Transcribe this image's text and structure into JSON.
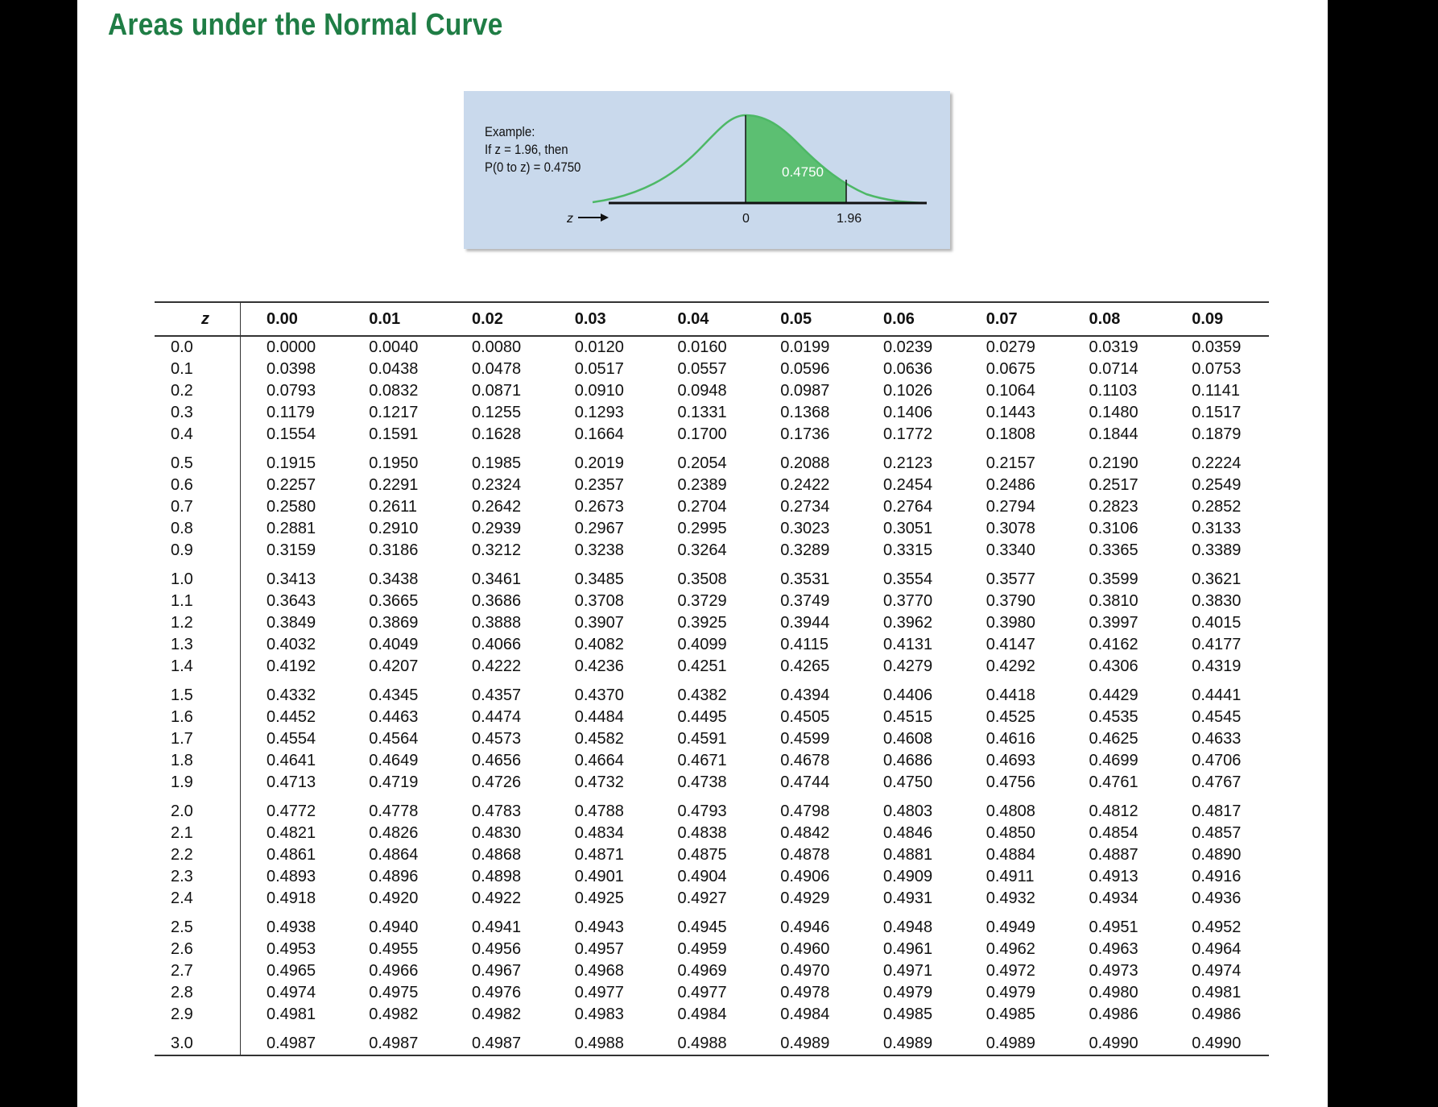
{
  "title": "Areas under the Normal Curve",
  "example": {
    "line1": "Example:",
    "line2": "If z = 1.96, then",
    "line3": "P(0 to z) = 0.4750",
    "area_label": "0.4750",
    "axis_label": "z",
    "tick_zero": "0",
    "tick_z": "1.96",
    "shade_color": "#5cbf72",
    "curve_color": "#4db866"
  },
  "table": {
    "header_z": "z",
    "columns": [
      "0.00",
      "0.01",
      "0.02",
      "0.03",
      "0.04",
      "0.05",
      "0.06",
      "0.07",
      "0.08",
      "0.09"
    ],
    "rows": [
      {
        "z": "0.0",
        "vals": [
          "0.0000",
          "0.0040",
          "0.0080",
          "0.0120",
          "0.0160",
          "0.0199",
          "0.0239",
          "0.0279",
          "0.0319",
          "0.0359"
        ]
      },
      {
        "z": "0.1",
        "vals": [
          "0.0398",
          "0.0438",
          "0.0478",
          "0.0517",
          "0.0557",
          "0.0596",
          "0.0636",
          "0.0675",
          "0.0714",
          "0.0753"
        ]
      },
      {
        "z": "0.2",
        "vals": [
          "0.0793",
          "0.0832",
          "0.0871",
          "0.0910",
          "0.0948",
          "0.0987",
          "0.1026",
          "0.1064",
          "0.1103",
          "0.1141"
        ]
      },
      {
        "z": "0.3",
        "vals": [
          "0.1179",
          "0.1217",
          "0.1255",
          "0.1293",
          "0.1331",
          "0.1368",
          "0.1406",
          "0.1443",
          "0.1480",
          "0.1517"
        ]
      },
      {
        "z": "0.4",
        "vals": [
          "0.1554",
          "0.1591",
          "0.1628",
          "0.1664",
          "0.1700",
          "0.1736",
          "0.1772",
          "0.1808",
          "0.1844",
          "0.1879"
        ]
      },
      {
        "z": "0.5",
        "vals": [
          "0.1915",
          "0.1950",
          "0.1985",
          "0.2019",
          "0.2054",
          "0.2088",
          "0.2123",
          "0.2157",
          "0.2190",
          "0.2224"
        ]
      },
      {
        "z": "0.6",
        "vals": [
          "0.2257",
          "0.2291",
          "0.2324",
          "0.2357",
          "0.2389",
          "0.2422",
          "0.2454",
          "0.2486",
          "0.2517",
          "0.2549"
        ]
      },
      {
        "z": "0.7",
        "vals": [
          "0.2580",
          "0.2611",
          "0.2642",
          "0.2673",
          "0.2704",
          "0.2734",
          "0.2764",
          "0.2794",
          "0.2823",
          "0.2852"
        ]
      },
      {
        "z": "0.8",
        "vals": [
          "0.2881",
          "0.2910",
          "0.2939",
          "0.2967",
          "0.2995",
          "0.3023",
          "0.3051",
          "0.3078",
          "0.3106",
          "0.3133"
        ]
      },
      {
        "z": "0.9",
        "vals": [
          "0.3159",
          "0.3186",
          "0.3212",
          "0.3238",
          "0.3264",
          "0.3289",
          "0.3315",
          "0.3340",
          "0.3365",
          "0.3389"
        ]
      },
      {
        "z": "1.0",
        "vals": [
          "0.3413",
          "0.3438",
          "0.3461",
          "0.3485",
          "0.3508",
          "0.3531",
          "0.3554",
          "0.3577",
          "0.3599",
          "0.3621"
        ]
      },
      {
        "z": "1.1",
        "vals": [
          "0.3643",
          "0.3665",
          "0.3686",
          "0.3708",
          "0.3729",
          "0.3749",
          "0.3770",
          "0.3790",
          "0.3810",
          "0.3830"
        ]
      },
      {
        "z": "1.2",
        "vals": [
          "0.3849",
          "0.3869",
          "0.3888",
          "0.3907",
          "0.3925",
          "0.3944",
          "0.3962",
          "0.3980",
          "0.3997",
          "0.4015"
        ]
      },
      {
        "z": "1.3",
        "vals": [
          "0.4032",
          "0.4049",
          "0.4066",
          "0.4082",
          "0.4099",
          "0.4115",
          "0.4131",
          "0.4147",
          "0.4162",
          "0.4177"
        ]
      },
      {
        "z": "1.4",
        "vals": [
          "0.4192",
          "0.4207",
          "0.4222",
          "0.4236",
          "0.4251",
          "0.4265",
          "0.4279",
          "0.4292",
          "0.4306",
          "0.4319"
        ]
      },
      {
        "z": "1.5",
        "vals": [
          "0.4332",
          "0.4345",
          "0.4357",
          "0.4370",
          "0.4382",
          "0.4394",
          "0.4406",
          "0.4418",
          "0.4429",
          "0.4441"
        ]
      },
      {
        "z": "1.6",
        "vals": [
          "0.4452",
          "0.4463",
          "0.4474",
          "0.4484",
          "0.4495",
          "0.4505",
          "0.4515",
          "0.4525",
          "0.4535",
          "0.4545"
        ]
      },
      {
        "z": "1.7",
        "vals": [
          "0.4554",
          "0.4564",
          "0.4573",
          "0.4582",
          "0.4591",
          "0.4599",
          "0.4608",
          "0.4616",
          "0.4625",
          "0.4633"
        ]
      },
      {
        "z": "1.8",
        "vals": [
          "0.4641",
          "0.4649",
          "0.4656",
          "0.4664",
          "0.4671",
          "0.4678",
          "0.4686",
          "0.4693",
          "0.4699",
          "0.4706"
        ]
      },
      {
        "z": "1.9",
        "vals": [
          "0.4713",
          "0.4719",
          "0.4726",
          "0.4732",
          "0.4738",
          "0.4744",
          "0.4750",
          "0.4756",
          "0.4761",
          "0.4767"
        ]
      },
      {
        "z": "2.0",
        "vals": [
          "0.4772",
          "0.4778",
          "0.4783",
          "0.4788",
          "0.4793",
          "0.4798",
          "0.4803",
          "0.4808",
          "0.4812",
          "0.4817"
        ]
      },
      {
        "z": "2.1",
        "vals": [
          "0.4821",
          "0.4826",
          "0.4830",
          "0.4834",
          "0.4838",
          "0.4842",
          "0.4846",
          "0.4850",
          "0.4854",
          "0.4857"
        ]
      },
      {
        "z": "2.2",
        "vals": [
          "0.4861",
          "0.4864",
          "0.4868",
          "0.4871",
          "0.4875",
          "0.4878",
          "0.4881",
          "0.4884",
          "0.4887",
          "0.4890"
        ]
      },
      {
        "z": "2.3",
        "vals": [
          "0.4893",
          "0.4896",
          "0.4898",
          "0.4901",
          "0.4904",
          "0.4906",
          "0.4909",
          "0.4911",
          "0.4913",
          "0.4916"
        ]
      },
      {
        "z": "2.4",
        "vals": [
          "0.4918",
          "0.4920",
          "0.4922",
          "0.4925",
          "0.4927",
          "0.4929",
          "0.4931",
          "0.4932",
          "0.4934",
          "0.4936"
        ]
      },
      {
        "z": "2.5",
        "vals": [
          "0.4938",
          "0.4940",
          "0.4941",
          "0.4943",
          "0.4945",
          "0.4946",
          "0.4948",
          "0.4949",
          "0.4951",
          "0.4952"
        ]
      },
      {
        "z": "2.6",
        "vals": [
          "0.4953",
          "0.4955",
          "0.4956",
          "0.4957",
          "0.4959",
          "0.4960",
          "0.4961",
          "0.4962",
          "0.4963",
          "0.4964"
        ]
      },
      {
        "z": "2.7",
        "vals": [
          "0.4965",
          "0.4966",
          "0.4967",
          "0.4968",
          "0.4969",
          "0.4970",
          "0.4971",
          "0.4972",
          "0.4973",
          "0.4974"
        ]
      },
      {
        "z": "2.8",
        "vals": [
          "0.4974",
          "0.4975",
          "0.4976",
          "0.4977",
          "0.4977",
          "0.4978",
          "0.4979",
          "0.4979",
          "0.4980",
          "0.4981"
        ]
      },
      {
        "z": "2.9",
        "vals": [
          "0.4981",
          "0.4982",
          "0.4982",
          "0.4983",
          "0.4984",
          "0.4984",
          "0.4985",
          "0.4985",
          "0.4986",
          "0.4986"
        ]
      },
      {
        "z": "3.0",
        "vals": [
          "0.4987",
          "0.4987",
          "0.4987",
          "0.4988",
          "0.4988",
          "0.4989",
          "0.4989",
          "0.4989",
          "0.4990",
          "0.4990"
        ]
      }
    ]
  }
}
